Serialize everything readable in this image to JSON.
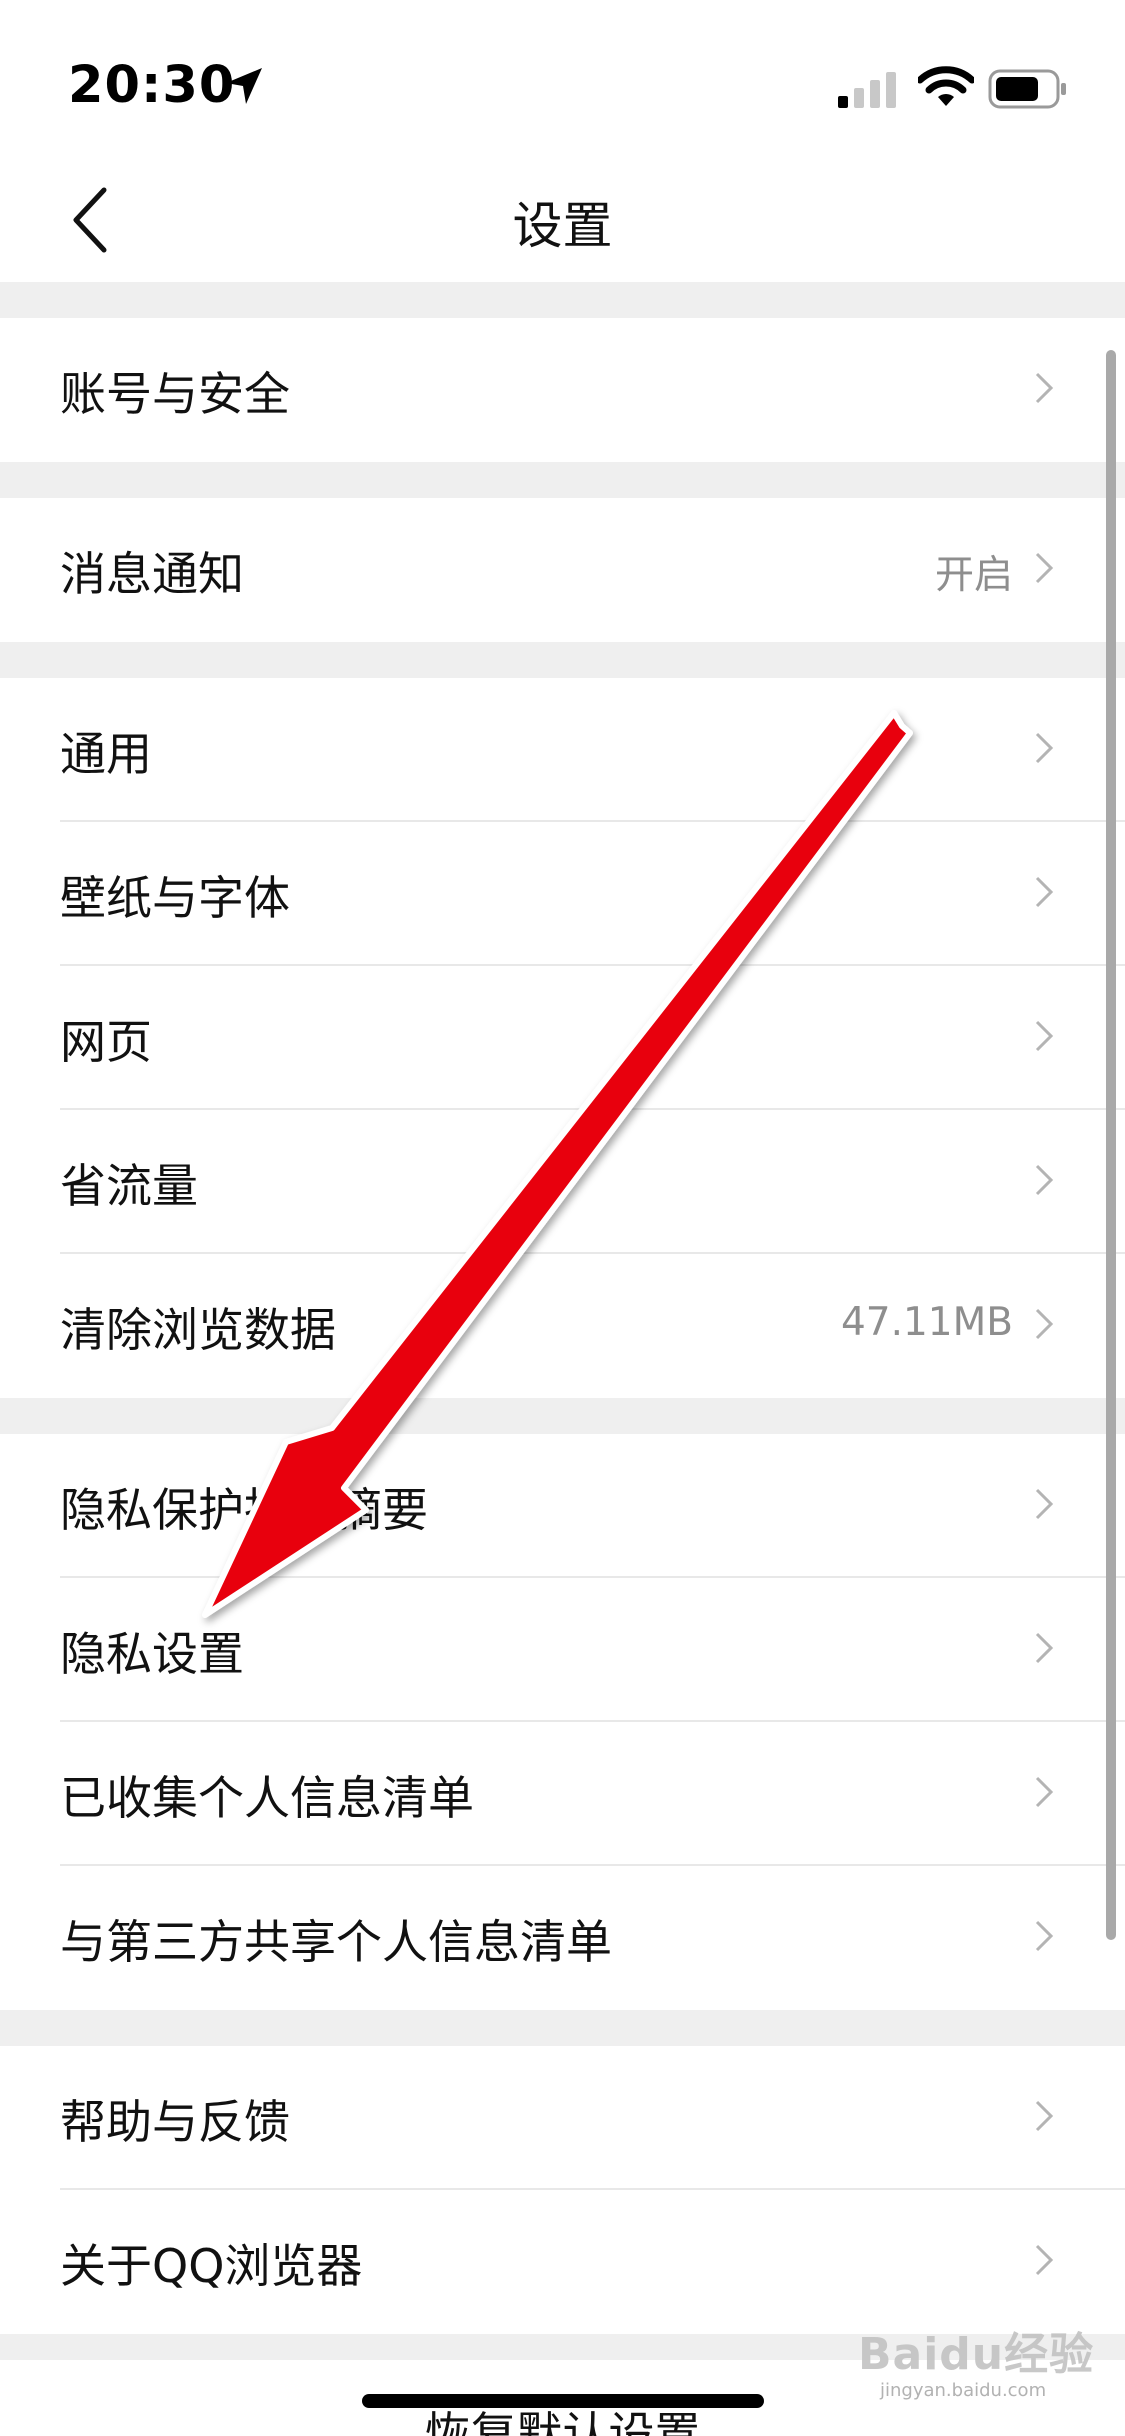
{
  "status_bar": {
    "time": "20:30"
  },
  "nav": {
    "title": "设置"
  },
  "groups": [
    {
      "items": [
        {
          "label": "账号与安全",
          "value": ""
        }
      ]
    },
    {
      "items": [
        {
          "label": "消息通知",
          "value": "开启"
        }
      ]
    },
    {
      "items": [
        {
          "label": "通用",
          "value": ""
        },
        {
          "label": "壁纸与字体",
          "value": ""
        },
        {
          "label": "网页",
          "value": ""
        },
        {
          "label": "省流量",
          "value": ""
        },
        {
          "label": "清除浏览数据",
          "value": "47.11MB"
        }
      ]
    },
    {
      "items": [
        {
          "label": "隐私保护指引摘要",
          "value": ""
        },
        {
          "label": "隐私设置",
          "value": ""
        },
        {
          "label": "已收集个人信息清单",
          "value": ""
        },
        {
          "label": "与第三方共享个人信息清单",
          "value": ""
        }
      ]
    },
    {
      "items": [
        {
          "label": "帮助与反馈",
          "value": ""
        },
        {
          "label": "关于QQ浏览器",
          "value": ""
        }
      ]
    }
  ],
  "footer": {
    "restore_label": "恢复默认设置"
  },
  "watermark": {
    "text": "Baidu经验",
    "sub": "jingyan.baidu.com"
  },
  "colors": {
    "annotation_arrow": "#e8000a",
    "secondary_text": "#8e8e8e",
    "background": "#efefef"
  }
}
